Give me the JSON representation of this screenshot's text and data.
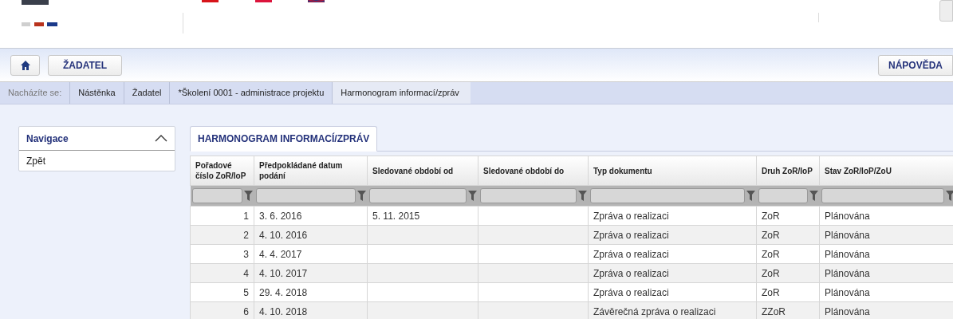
{
  "toolbar": {
    "buttons": [
      {
        "kind": "home"
      },
      {
        "kind": "text",
        "label": "ŽADATEL"
      }
    ],
    "help_button": "NÁPOVĚDA"
  },
  "breadcrumb": {
    "label": "Nacházíte se:",
    "items": [
      "Nástěnka",
      "Žadatel",
      "*Školení 0001 - administrace projektu",
      "Harmonogram informací/zpráv"
    ]
  },
  "navigation": {
    "title": "Navigace",
    "expanded": true,
    "items": [
      "Zpět"
    ]
  },
  "tabs": [
    {
      "label": "HARMONOGRAM INFORMACÍ/ZPRÁV",
      "selected": true
    }
  ],
  "table": {
    "columns": [
      "Pořadové číslo ZoR/IoP",
      "Předpokládané datum podání",
      "Sledované období od",
      "Sledované období do",
      "Typ dokumentu",
      "Druh ZoR/IoP",
      "Stav ZoR/IoP/ZoU"
    ],
    "rows": [
      {
        "cells": [
          "1",
          "3. 6. 2016",
          "5. 11. 2015",
          null,
          "Zpráva o realizaci",
          "ZoR",
          "Plánována"
        ]
      },
      {
        "cells": [
          "2",
          "4. 10. 2016",
          null,
          null,
          "Zpráva o realizaci",
          "ZoR",
          "Plánována"
        ]
      },
      {
        "cells": [
          "3",
          "4. 4. 2017",
          null,
          null,
          "Zpráva o realizaci",
          "ZoR",
          "Plánována"
        ]
      },
      {
        "cells": [
          "4",
          "4. 10. 2017",
          null,
          null,
          "Zpráva o realizaci",
          "ZoR",
          "Plánována"
        ]
      },
      {
        "cells": [
          "5",
          "29. 4. 2018",
          null,
          null,
          "Zpráva o realizaci",
          "ZoR",
          "Plánována"
        ]
      },
      {
        "cells": [
          "6",
          "4. 10. 2018",
          null,
          null,
          "Závěrečná zpráva o realizaci",
          "ZZoR",
          "Plánována"
        ]
      }
    ]
  }
}
